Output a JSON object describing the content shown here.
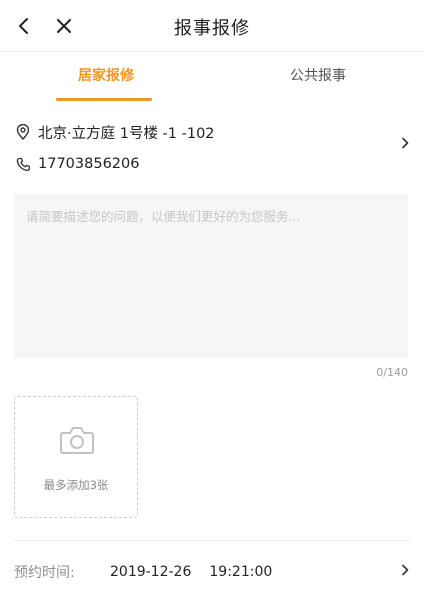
{
  "header": {
    "title": "报事报修",
    "back_icon": "back-arrow-icon",
    "close_icon": "close-icon"
  },
  "tabs": [
    {
      "label": "居家报修",
      "active": true
    },
    {
      "label": "公共报事",
      "active": false
    }
  ],
  "address": {
    "text": "北京·立方庭 1号楼 -1 -102",
    "icon": "location-pin-icon"
  },
  "phone": {
    "text": "17703856206",
    "icon": "phone-icon"
  },
  "description": {
    "placeholder": "请简要描述您的问题，以便我们更好的为您服务...",
    "value": "",
    "counter": "0/140"
  },
  "upload": {
    "hint": "最多添加3张",
    "icon": "camera-icon"
  },
  "appointment": {
    "label": "预约时间:",
    "date": "2019-12-26",
    "time": "19:21:00"
  },
  "colors": {
    "accent": "#f0962a",
    "text": "#222222",
    "muted": "#8f8f8f",
    "placeholder": "#c7c7c7",
    "field_bg": "#f6f6f6"
  }
}
